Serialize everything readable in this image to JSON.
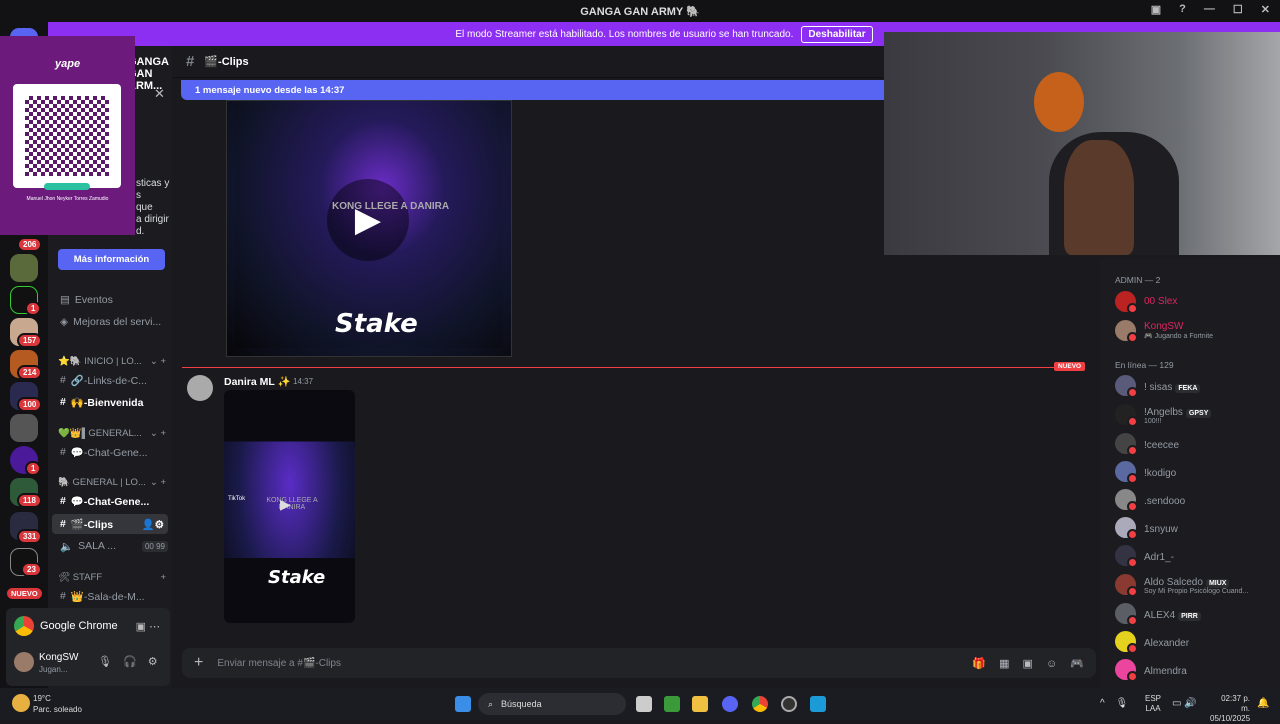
{
  "window": {
    "title": "GANGA GAN ARMY 🐘"
  },
  "banner": {
    "text": "El modo Streamer está habilitado. Los nombres de usuario se han truncado.",
    "button": "Deshabilitar"
  },
  "server": {
    "name": "GANGA GAN ARM..."
  },
  "servers": [
    {
      "badge": "206"
    },
    {
      "badge": ""
    },
    {
      "badge": "1"
    },
    {
      "badge": "157"
    },
    {
      "badge": "214"
    },
    {
      "badge": "100"
    },
    {
      "badge": ""
    },
    {
      "badge": "1"
    },
    {
      "badge": "118"
    },
    {
      "badge": "331"
    },
    {
      "badge": "23"
    }
  ],
  "new_pill": "NUEVO",
  "promo": {
    "text_lines": [
      "sticas y",
      "s",
      "que",
      "a dirigir",
      "d."
    ],
    "button": "Más información"
  },
  "yape": {
    "logo": "yape",
    "name": "Manuel Jhon Neyker Torres Zamudio"
  },
  "channels": {
    "events": "Eventos",
    "boosts": "Mejoras del servi...",
    "cat1": "⭐🐘 INICIO | LO...",
    "links": "🔗-Links-de-C...",
    "welcome": "🙌-Bienvenida",
    "cat2": "💚👑▌GENERAL...",
    "chat1": "💬-Chat-Gene...",
    "cat3": "🐘 GENERAL | LO...",
    "chat2": "💬-Chat-Gene...",
    "clips": "🎬-Clips",
    "voice": "SALA ...",
    "voice_a": "00",
    "voice_b": "99",
    "cat4": "🛠 STAFF",
    "sala": "👑-Sala-de-M..."
  },
  "activity": {
    "app": "Google Chrome"
  },
  "user": {
    "name": "KongSW",
    "status": "Jugan..."
  },
  "channel_header": {
    "name": "🎬-Clips"
  },
  "new_messages": "1 mensaje nuevo desde las 14:37",
  "divider_label": "NUEVO",
  "video_text": "KONG LLEGE A DANIRA",
  "stake": "Stake",
  "message": {
    "author": "Danira ML ✨",
    "time": "14:37",
    "tiktok": "TikTok"
  },
  "composer": {
    "placeholder": "Enviar mensaje a #🎬-Clips"
  },
  "members": {
    "admin_header": "ADMIN — 2",
    "online_header": "En línea — 129",
    "admins": [
      {
        "name": "00 Slex",
        "color": "#e0245e",
        "status": ""
      },
      {
        "name": "KongSW",
        "color": "#e0245e",
        "status": "Jugando a Fortnite"
      }
    ],
    "online": [
      {
        "name": "! sisas",
        "tag": "FEKA",
        "status": "",
        "color": "#5a5a7a"
      },
      {
        "name": "!Angelbs",
        "tag": "GPSY",
        "status": "100!!!",
        "color": "#222"
      },
      {
        "name": "!ceecee",
        "tag": "",
        "status": "",
        "color": "#444"
      },
      {
        "name": "!kodigo",
        "tag": "",
        "status": "",
        "color": "#5a6aa0"
      },
      {
        "name": ".sendooo",
        "tag": "",
        "status": "",
        "color": "#888"
      },
      {
        "name": "1snyuw",
        "tag": "",
        "status": "",
        "color": "#aab"
      },
      {
        "name": "Adr1_-",
        "tag": "",
        "status": "",
        "color": "#334"
      },
      {
        "name": "Aldo Salcedo",
        "tag": "MIUX",
        "status": "Soy Mi Propio Psicólogo Cuand...",
        "color": "#8a3a30"
      },
      {
        "name": "ALEX4",
        "tag": "PIRR",
        "status": "",
        "color": "#5c5e66"
      },
      {
        "name": "Alexander",
        "tag": "",
        "status": "",
        "color": "#e4d21e"
      },
      {
        "name": "Almendra",
        "tag": "",
        "status": "",
        "color": "#eb459e"
      }
    ]
  },
  "taskbar": {
    "temp": "19°C",
    "weather": "Parc. soleado",
    "search": "Búsqueda",
    "lang1": "ESP",
    "lang2": "LAA",
    "time": "02:37 p. m.",
    "date": "05/10/2025"
  }
}
